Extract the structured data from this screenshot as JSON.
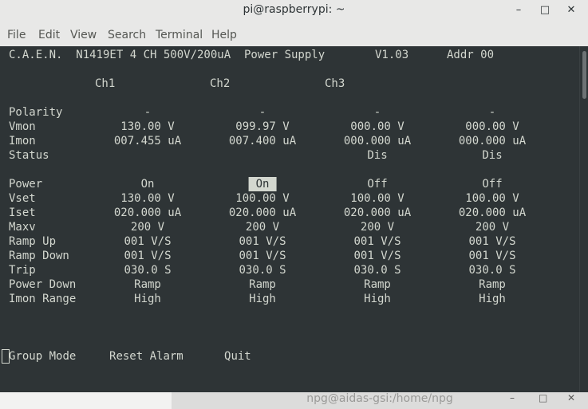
{
  "window": {
    "title": "pi@raspberrypi: ~",
    "minimize": "–",
    "maximize": "□",
    "close": "✕"
  },
  "menu": [
    "File",
    "Edit",
    "View",
    "Search",
    "Terminal",
    "Help"
  ],
  "terminal": {
    "header": {
      "model": "C.A.E.N.  N1419ET 4 CH 500V/200uA  Power Supply",
      "version": "V1.03",
      "address": "Addr 00"
    },
    "channel_headers": [
      "Ch1",
      "Ch2",
      "Ch3"
    ],
    "rows": [
      {
        "label": "Polarity",
        "values": [
          "-",
          "-",
          "-",
          "-"
        ]
      },
      {
        "label": "Vmon",
        "values": [
          "130.00 V",
          "099.97 V",
          "000.00 V",
          "000.00 V"
        ]
      },
      {
        "label": "Imon",
        "values": [
          "007.455 uA",
          "007.400 uA",
          "000.000 uA",
          "000.000 uA"
        ]
      },
      {
        "label": "Status",
        "values": [
          "",
          "",
          "Dis",
          "Dis"
        ]
      },
      {
        "label": "Power",
        "values": [
          "On",
          "On",
          "Off",
          "Off"
        ],
        "selected_index": 1
      },
      {
        "label": "Vset",
        "values": [
          "130.00 V",
          "100.00 V",
          "100.00 V",
          "100.00 V"
        ]
      },
      {
        "label": "Iset",
        "values": [
          "020.000 uA",
          "020.000 uA",
          "020.000 uA",
          "020.000 uA"
        ]
      },
      {
        "label": "Maxv",
        "values": [
          "200 V",
          "200 V",
          "200 V",
          "200 V"
        ]
      },
      {
        "label": "Ramp Up",
        "values": [
          "001 V/S",
          "001 V/S",
          "001 V/S",
          "001 V/S"
        ]
      },
      {
        "label": "Ramp Down",
        "values": [
          "001 V/S",
          "001 V/S",
          "001 V/S",
          "001 V/S"
        ]
      },
      {
        "label": "Trip",
        "values": [
          "030.0 S",
          "030.0 S",
          "030.0 S",
          "030.0 S"
        ]
      },
      {
        "label": "Power Down",
        "values": [
          "Ramp",
          "Ramp",
          "Ramp",
          "Ramp"
        ]
      },
      {
        "label": "Imon Range",
        "values": [
          "High",
          "High",
          "High",
          "High"
        ]
      }
    ],
    "commands": [
      {
        "key": "G",
        "rest": "roup Mode"
      },
      {
        "key": "R",
        "rest": "eset Alarm"
      },
      {
        "key": "Q",
        "rest": "uit"
      }
    ]
  },
  "background_window": {
    "title": "npg@aidas-gsi:/home/npg",
    "minimize": "–",
    "maximize": "□",
    "close": "✕"
  },
  "colors": {
    "terminal_bg": "#2e3436",
    "terminal_fg": "#d3d7cf",
    "chrome_bg": "#e8e8e7"
  }
}
